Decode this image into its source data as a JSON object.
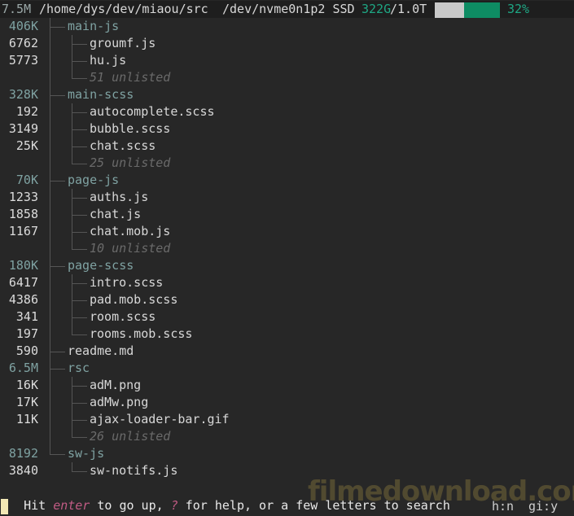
{
  "header": {
    "dir_size": "7.5M",
    "path": "/home/dys/dev/miaou/src",
    "device": "/dev/nvme0n1p2 SSD",
    "used": "322G",
    "total": "/1.0T",
    "usage_percent": "32%",
    "usage_fraction": 0.32,
    "colors": {
      "accent": "#1ea784",
      "bar_fill": "#0e8c63",
      "bar_bg": "#c9c9c9"
    }
  },
  "tree": [
    {
      "size": "406K",
      "name": "main-js",
      "kind": "dir"
    },
    {
      "size": "6762",
      "name": "groumf.js",
      "kind": "file"
    },
    {
      "size": "5773",
      "name": "hu.js",
      "kind": "file"
    },
    {
      "size": "",
      "name": "51 unlisted",
      "kind": "unlisted"
    },
    {
      "size": "328K",
      "name": "main-scss",
      "kind": "dir"
    },
    {
      "size": "192",
      "name": "autocomplete.scss",
      "kind": "file"
    },
    {
      "size": "3149",
      "name": "bubble.scss",
      "kind": "file"
    },
    {
      "size": "25K",
      "name": "chat.scss",
      "kind": "file"
    },
    {
      "size": "",
      "name": "25 unlisted",
      "kind": "unlisted"
    },
    {
      "size": "70K",
      "name": "page-js",
      "kind": "dir"
    },
    {
      "size": "1233",
      "name": "auths.js",
      "kind": "file"
    },
    {
      "size": "1858",
      "name": "chat.js",
      "kind": "file"
    },
    {
      "size": "1167",
      "name": "chat.mob.js",
      "kind": "file"
    },
    {
      "size": "",
      "name": "10 unlisted",
      "kind": "unlisted"
    },
    {
      "size": "180K",
      "name": "page-scss",
      "kind": "dir"
    },
    {
      "size": "6417",
      "name": "intro.scss",
      "kind": "file"
    },
    {
      "size": "4386",
      "name": "pad.mob.scss",
      "kind": "file"
    },
    {
      "size": "341",
      "name": "room.scss",
      "kind": "file"
    },
    {
      "size": "197",
      "name": "rooms.mob.scss",
      "kind": "file"
    },
    {
      "size": "590",
      "name": "readme.md",
      "kind": "rootfile"
    },
    {
      "size": "6.5M",
      "name": "rsc",
      "kind": "dir"
    },
    {
      "size": "16K",
      "name": "adM.png",
      "kind": "file"
    },
    {
      "size": "17K",
      "name": "adMw.png",
      "kind": "file"
    },
    {
      "size": "11K",
      "name": "ajax-loader-bar.gif",
      "kind": "file"
    },
    {
      "size": "",
      "name": "26 unlisted",
      "kind": "unlisted"
    },
    {
      "size": "8192",
      "name": "sw-js",
      "kind": "dir"
    },
    {
      "size": "3840",
      "name": "sw-notifs.js",
      "kind": "file"
    }
  ],
  "help": {
    "prefix": "Hit ",
    "key1": "enter",
    "mid1": " to go up, ",
    "key2": "?",
    "suffix": " for help, or a few letters to search"
  },
  "status": {
    "hidden_toggle": "h:n",
    "gitignore_toggle": "gi:y"
  },
  "watermark": "filmedownload.com"
}
